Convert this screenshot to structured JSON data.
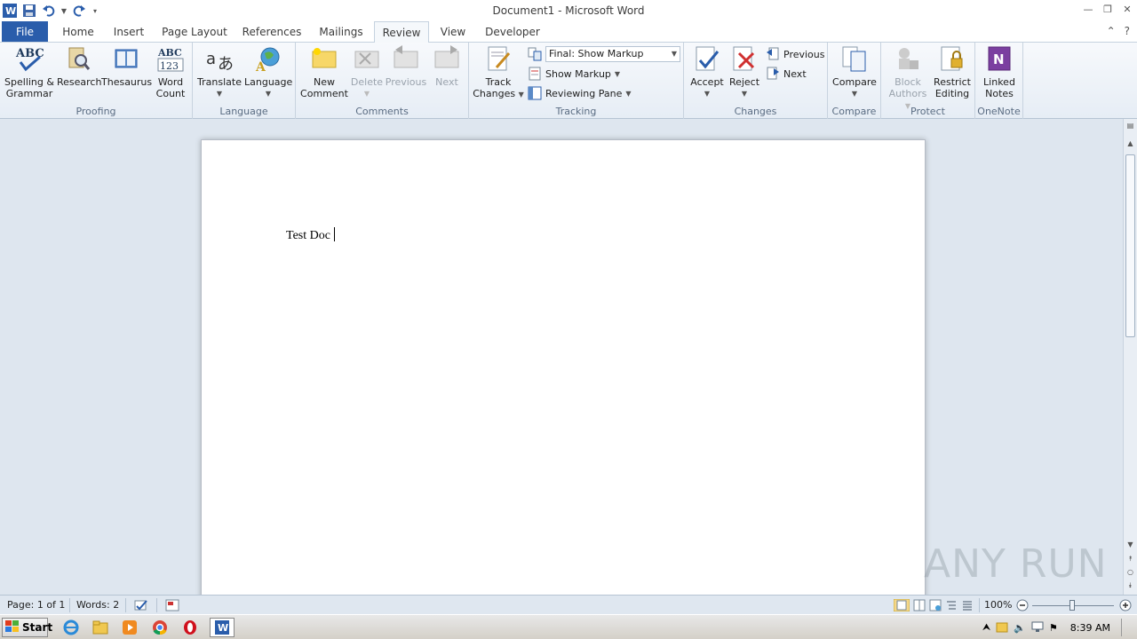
{
  "window": {
    "title": "Document1 - Microsoft Word"
  },
  "tabs": [
    {
      "label": "File"
    },
    {
      "label": "Home"
    },
    {
      "label": "Insert"
    },
    {
      "label": "Page Layout"
    },
    {
      "label": "References"
    },
    {
      "label": "Mailings"
    },
    {
      "label": "Review"
    },
    {
      "label": "View"
    },
    {
      "label": "Developer"
    }
  ],
  "ribbon": {
    "proofing": {
      "label": "Proofing",
      "spelling": "Spelling &\nGrammar",
      "spelling_l1": "Spelling &",
      "spelling_l2": "Grammar",
      "research": "Research",
      "thesaurus": "Thesaurus",
      "wordcount_l1": "Word",
      "wordcount_l2": "Count"
    },
    "language": {
      "label": "Language",
      "translate": "Translate",
      "language": "Language"
    },
    "comments": {
      "label": "Comments",
      "new_l1": "New",
      "new_l2": "Comment",
      "delete": "Delete",
      "previous": "Previous",
      "next": "Next"
    },
    "tracking": {
      "label": "Tracking",
      "track_l1": "Track",
      "track_l2": "Changes",
      "display_for_review": "Final: Show Markup",
      "show_markup": "Show Markup",
      "reviewing_pane": "Reviewing Pane"
    },
    "changes": {
      "label": "Changes",
      "accept": "Accept",
      "reject": "Reject",
      "previous": "Previous",
      "next": "Next"
    },
    "compare": {
      "label": "Compare",
      "compare": "Compare"
    },
    "protect": {
      "label": "Protect",
      "block_l1": "Block",
      "block_l2": "Authors",
      "restrict_l1": "Restrict",
      "restrict_l2": "Editing"
    },
    "onenote": {
      "label": "OneNote",
      "linked_l1": "Linked",
      "linked_l2": "Notes"
    }
  },
  "document": {
    "text": "Test Doc"
  },
  "statusbar": {
    "page": "Page: 1 of 1",
    "words": "Words: 2",
    "zoom": "100%"
  },
  "taskbar": {
    "start": "Start",
    "clock": "8:39 AM"
  },
  "watermark": "ANY RUN",
  "colors": {
    "file_tab": "#2a5dab",
    "ribbon_bg": "#e6edf5",
    "doc_bg": "#dee6ef"
  }
}
